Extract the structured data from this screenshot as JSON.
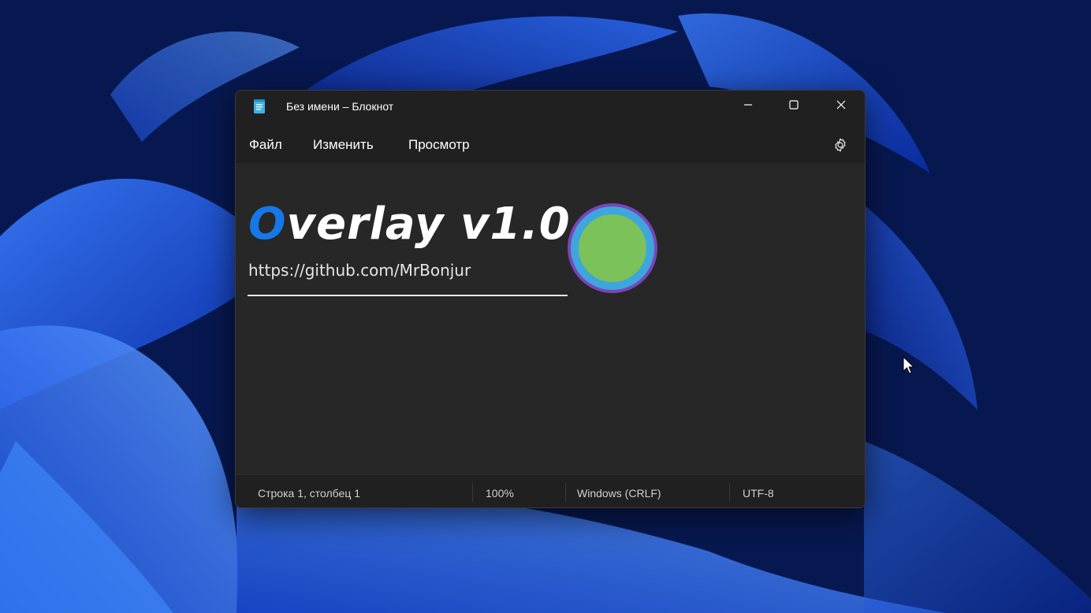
{
  "window": {
    "title": "Без имени – Блокнот",
    "app_icon": "notepad-icon",
    "controls": [
      "minimize-icon",
      "maximize-icon",
      "close-icon"
    ]
  },
  "menu": {
    "items": [
      {
        "label": "Файл"
      },
      {
        "label": "Изменить"
      },
      {
        "label": "Просмотр"
      }
    ],
    "settings_icon": "gear-icon"
  },
  "overlay": {
    "title_accent": "O",
    "title_rest": "verlay v1.0",
    "url": "https://github.com/MrBonjur",
    "colors": {
      "accent": "#1677e6",
      "dot_outer": "#7a45b8",
      "dot_middle": "#3ea6dc",
      "dot_core": "#7cc25a"
    }
  },
  "status": {
    "position": "Строка 1, столбец 1",
    "zoom": "100%",
    "line_ending": "Windows (CRLF)",
    "encoding": "UTF-8"
  }
}
